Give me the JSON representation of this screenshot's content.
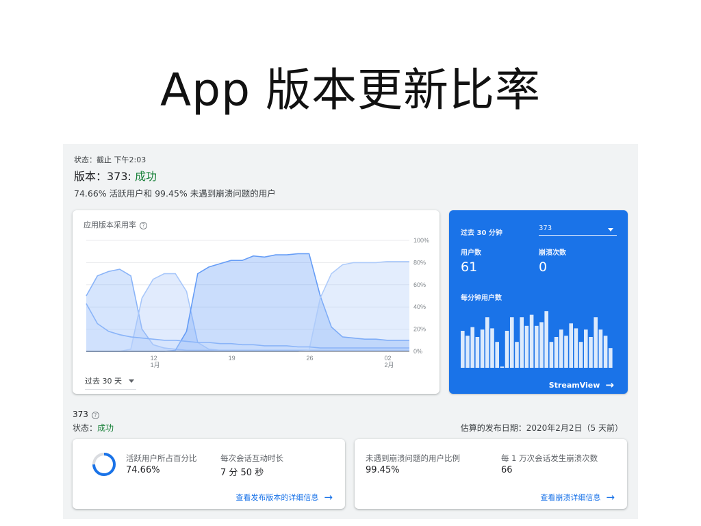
{
  "slide": {
    "title": "App 版本更新比率"
  },
  "console": {
    "status_line": "状态：截止 下午2:03",
    "version_prefix": "版本：373: ",
    "version_status": "成功",
    "summary": "74.66% 活跃用户和 99.45% 未遇到崩溃问题的用户"
  },
  "adoption_chart": {
    "title": "应用版本采用率",
    "range_label": "过去 30 天"
  },
  "chart_data": {
    "type": "area",
    "title": "应用版本采用率",
    "x": [
      1,
      2,
      3,
      4,
      5,
      6,
      7,
      8,
      9,
      10,
      11,
      12,
      13,
      14,
      15,
      16,
      17,
      18,
      19,
      20,
      21,
      22,
      23,
      24,
      25,
      26,
      27,
      28,
      29,
      30
    ],
    "x_tick_labels": [
      "12\n1月",
      "19",
      "26",
      "02\n2月"
    ],
    "ylim": [
      0,
      100
    ],
    "y_tick_labels": [
      "100%",
      "80%",
      "60%",
      "40%",
      "20%",
      "0%"
    ],
    "grid": true,
    "series": [
      {
        "name": "",
        "color": "#8ab4f8",
        "values": [
          50,
          68,
          72,
          74,
          68,
          20,
          6,
          3,
          2,
          1,
          1,
          1,
          1,
          1,
          1,
          1,
          1,
          1,
          1,
          1,
          1,
          1,
          1,
          1,
          1,
          1,
          1,
          1,
          1,
          1
        ]
      },
      {
        "name": "",
        "color": "#a8c7fa",
        "values": [
          0,
          0,
          0,
          0,
          2,
          48,
          65,
          70,
          70,
          54,
          8,
          2,
          1,
          1,
          1,
          1,
          1,
          1,
          1,
          1,
          1,
          1,
          1,
          1,
          1,
          1,
          1,
          1,
          1,
          1
        ]
      },
      {
        "name": "",
        "color": "#669df6",
        "values": [
          0,
          0,
          0,
          0,
          0,
          0,
          0,
          0,
          1,
          18,
          70,
          76,
          79,
          82,
          82,
          86,
          85,
          87,
          87,
          88,
          88,
          50,
          22,
          13,
          12,
          11,
          11,
          10,
          10,
          10
        ]
      },
      {
        "name": "",
        "color": "#aecbfa",
        "values": [
          0,
          0,
          0,
          0,
          0,
          0,
          0,
          0,
          0,
          0,
          0,
          0,
          0,
          0,
          0,
          0,
          0,
          0,
          0,
          0,
          1,
          48,
          70,
          78,
          80,
          80,
          80,
          81,
          81,
          81
        ]
      },
      {
        "name": "",
        "color": "#c6dafc",
        "values": [
          43,
          25,
          18,
          15,
          13,
          12,
          11,
          10,
          10,
          9,
          8,
          8,
          7,
          7,
          6,
          6,
          5,
          5,
          5,
          4,
          4,
          3,
          3,
          3,
          3,
          3,
          3,
          3,
          3,
          3
        ]
      }
    ]
  },
  "realtime": {
    "period_label": "过去 30 分钟",
    "version_select": "373",
    "users_label": "用户数",
    "users_value": "61",
    "crashes_label": "崩溃次数",
    "crashes_value": "0",
    "per_minute_label": "每分钟用户数",
    "per_minute_values": [
      3,
      2.6,
      3.3,
      2.5,
      3.1,
      4.1,
      3.2,
      2.1,
      0.1,
      3.0,
      4.1,
      2.1,
      4.1,
      3.4,
      4.3,
      3.4,
      3.7,
      4.6,
      2.1,
      2.5,
      3.1,
      2.6,
      3.6,
      3.2,
      2.1,
      3.1,
      2.5,
      4.1,
      3.1,
      2.6,
      1.6
    ],
    "streamview_label": "StreamView"
  },
  "version_details": {
    "version": "373",
    "status_prefix": "状态：",
    "status_value": "成功",
    "release_date": "估算的发布日期：2020年2月2日（5 天前）"
  },
  "stats": {
    "active_users_label": "活跃用户所占百分比",
    "active_users_value": "74.66%",
    "active_users_fraction": 0.7466,
    "engagement_label": "每次会话互动时长",
    "engagement_value": "7 分 50 秒",
    "release_link": "查看发布版本的详细信息",
    "crash_free_label": "未遇到崩溃问题的用户比例",
    "crash_free_value": "99.45%",
    "crashes_per_10k_label": "每 1 万次会话发生崩溃次数",
    "crashes_per_10k_value": "66",
    "crash_link": "查看崩溃详细信息"
  },
  "colors": {
    "accent": "#1a73e8",
    "success": "#188038"
  }
}
